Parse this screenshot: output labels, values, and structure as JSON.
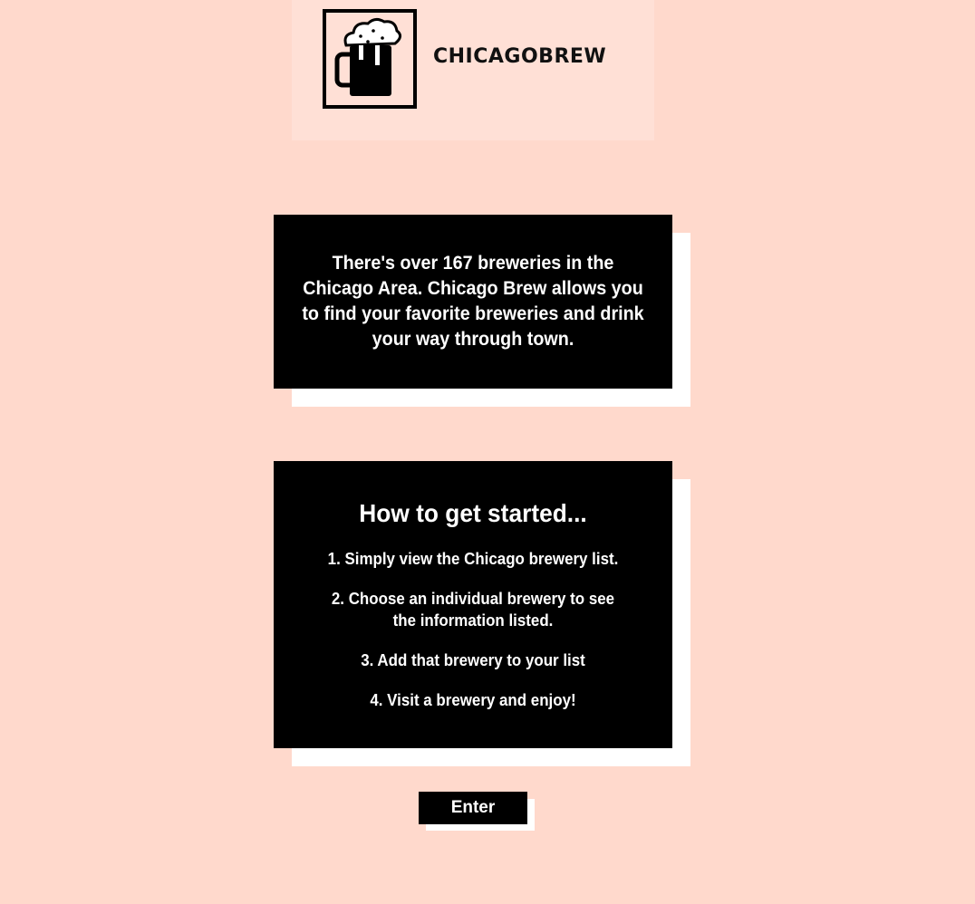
{
  "logo": {
    "brand_text": "CHICAGOBREW",
    "icon": "beer-mug-icon"
  },
  "intro": {
    "text": "There's over 167 breweries in the Chicago Area. Chicago Brew allows you to find your favorite breweries and drink your way through town."
  },
  "getting_started": {
    "title": "How to get started...",
    "steps": [
      "1. Simply view the Chicago brewery list.",
      "2. Choose an individual brewery to see the information listed.",
      "3. Add that brewery to your list",
      "4. Visit a brewery and enjoy!"
    ]
  },
  "enter_button": {
    "label": "Enter"
  },
  "colors": {
    "background": "#ffd9cc",
    "card": "#000000",
    "card_text": "#ffffff",
    "shadow": "#ffffff"
  }
}
